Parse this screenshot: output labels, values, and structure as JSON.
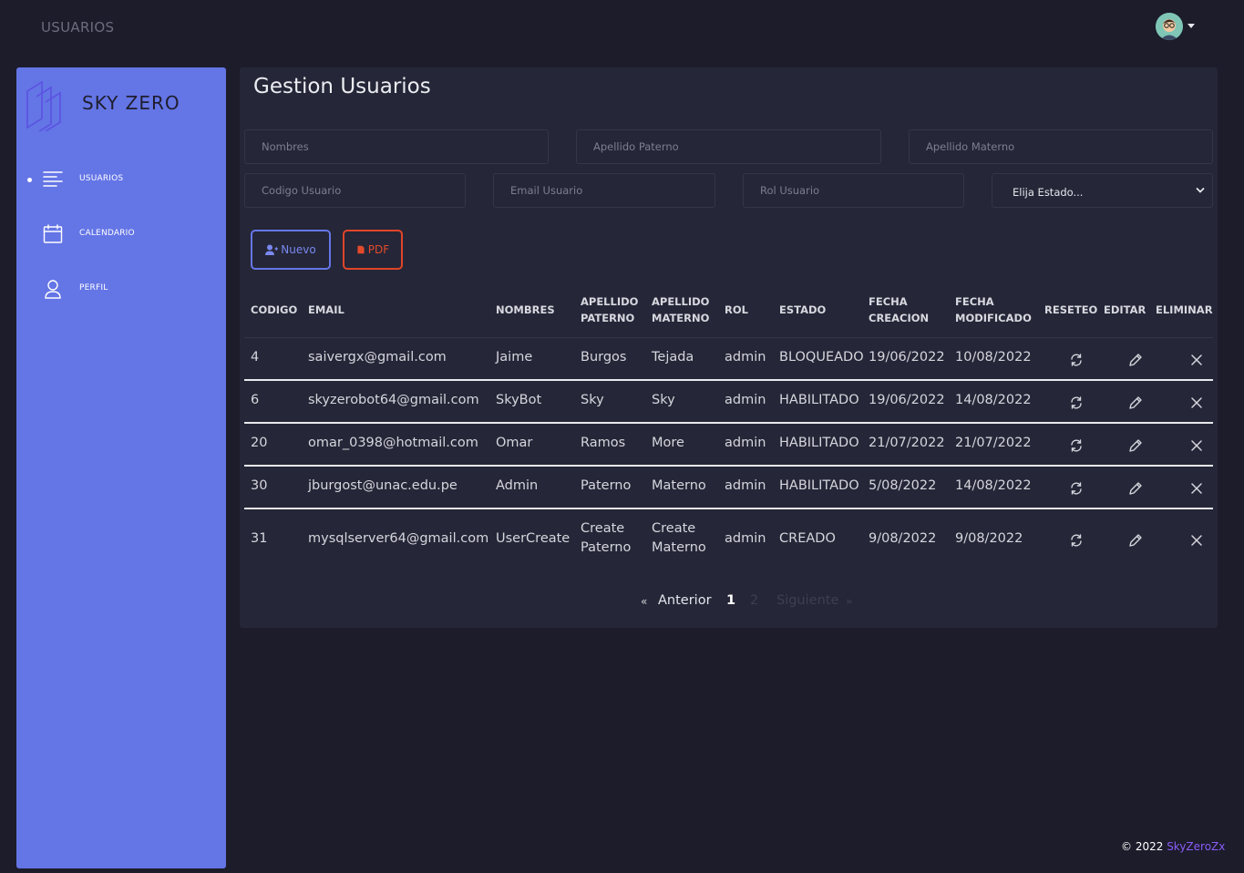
{
  "topbar": {
    "title": "USUARIOS",
    "avatar_icon": "user-avatar-icon"
  },
  "sidebar": {
    "brand": "SKY ZERO",
    "accent": "#6475e6",
    "items": [
      {
        "label": "USUARIOS",
        "icon": "list-icon",
        "active": true
      },
      {
        "label": "CALENDARIO",
        "icon": "calendar-icon",
        "active": false
      },
      {
        "label": "PERFIL",
        "icon": "user-icon",
        "active": false
      }
    ]
  },
  "main": {
    "title": "Gestion Usuarios",
    "filters": {
      "nombres": "Nombres",
      "apellido_paterno": "Apellido Paterno",
      "apellido_materno": "Apellido Materno",
      "codigo": "Codigo Usuario",
      "email": "Email Usuario",
      "rol": "Rol Usuario",
      "estado": "Elija Estado..."
    },
    "buttons": {
      "nuevo": "Nuevo",
      "pdf": "PDF"
    },
    "columns": [
      "CODIGO",
      "EMAIL",
      "NOMBRES",
      "APELLIDO PATERNO",
      "APELLIDO MATERNO",
      "ROL",
      "ESTADO",
      "FECHA CREACION",
      "FECHA MODIFICADO",
      "RESETEO",
      "EDITAR",
      "ELIMINAR"
    ],
    "column_lines": {
      "apellido_paterno": [
        "APELLIDO",
        "PATERNO"
      ],
      "apellido_materno": [
        "APELLIDO",
        "MATERNO"
      ],
      "fecha_creacion": [
        "FECHA",
        "CREACION"
      ],
      "fecha_modificado": [
        "FECHA",
        "MODIFICADO"
      ]
    },
    "rows": [
      {
        "codigo": "4",
        "email": "saivergx@gmail.com",
        "nombres": "Jaime",
        "ap_paterno": [
          "Burgos"
        ],
        "ap_materno": [
          "Tejada"
        ],
        "rol": "admin",
        "estado": "BLOQUEADO",
        "fecha_creacion": "19/06/2022",
        "fecha_modificado": "10/08/2022"
      },
      {
        "codigo": "6",
        "email": "skyzerobot64@gmail.com",
        "nombres": "SkyBot",
        "ap_paterno": [
          "Sky"
        ],
        "ap_materno": [
          "Sky"
        ],
        "rol": "admin",
        "estado": "HABILITADO",
        "fecha_creacion": "19/06/2022",
        "fecha_modificado": "14/08/2022"
      },
      {
        "codigo": "20",
        "email": "omar_0398@hotmail.com",
        "nombres": "Omar",
        "ap_paterno": [
          "Ramos"
        ],
        "ap_materno": [
          "More"
        ],
        "rol": "admin",
        "estado": "HABILITADO",
        "fecha_creacion": "21/07/2022",
        "fecha_modificado": "21/07/2022"
      },
      {
        "codigo": "30",
        "email": "jburgost@unac.edu.pe",
        "nombres": "Admin",
        "ap_paterno": [
          "Paterno"
        ],
        "ap_materno": [
          "Materno"
        ],
        "rol": "admin",
        "estado": "HABILITADO",
        "fecha_creacion": "5/08/2022",
        "fecha_modificado": "14/08/2022"
      },
      {
        "codigo": "31",
        "email": "mysqlserver64@gmail.com",
        "nombres": "UserCreate",
        "ap_paterno": [
          "Create",
          "Paterno"
        ],
        "ap_materno": [
          "Create",
          "Materno"
        ],
        "rol": "admin",
        "estado": "CREADO",
        "fecha_creacion": "9/08/2022",
        "fecha_modificado": "9/08/2022"
      }
    ],
    "row_icons": {
      "reset": "refresh-icon",
      "edit": "pencil-icon",
      "delete": "close-icon"
    },
    "pagination": {
      "prev_arrow": "«",
      "prev": "Anterior",
      "pages": [
        "1",
        "2"
      ],
      "current": "1",
      "next": "Siguiente",
      "next_arrow": "»"
    }
  },
  "footer": {
    "copyright": "© 2022",
    "brand": "SkyZeroZx",
    "brand_color": "#8a5cf6"
  }
}
